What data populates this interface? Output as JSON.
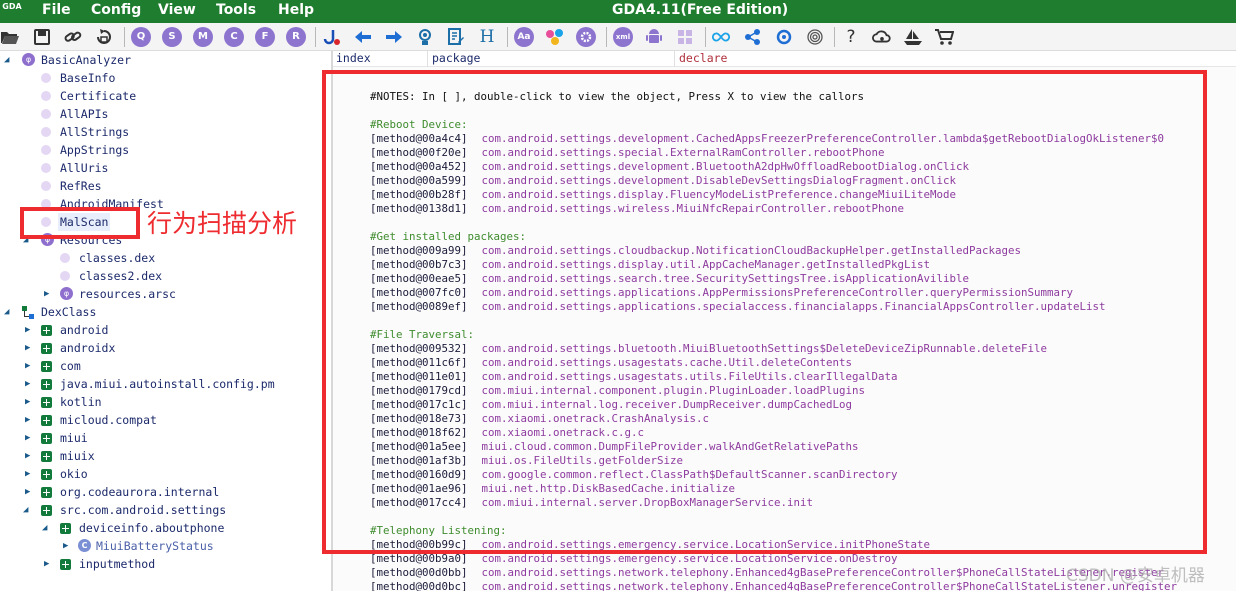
{
  "window": {
    "title": "GDA4.11(Free Edition)",
    "logo": "GDA"
  },
  "menu": [
    "File",
    "Config",
    "View",
    "Tools",
    "Help"
  ],
  "toolbar": {
    "icons": [
      "open-folder-icon",
      "save-icon",
      "link-icon",
      "refresh-icon",
      "q-icon",
      "s-icon",
      "m-icon",
      "c-icon",
      "f-icon",
      "r-icon",
      "jump-icon",
      "back-arrow-icon",
      "forward-arrow-icon",
      "bulb-icon",
      "edit-icon",
      "h-icon",
      "font-icon",
      "network-icon",
      "gear-icon",
      "xml-icon",
      "android-icon",
      "windows-icon",
      "infinity-icon",
      "graph-icon",
      "crosshair-icon",
      "fingerprint-icon",
      "help-icon",
      "cloud-icon",
      "ship-icon",
      "cart-icon"
    ],
    "letters": {
      "q": "Q",
      "s": "S",
      "m": "M",
      "c": "C",
      "f": "F",
      "r": "R",
      "h": "H",
      "help": "?",
      "font": "Aa",
      "xml": "xml"
    }
  },
  "tree": {
    "root": "BasicAnalyzer",
    "analyzer_items": [
      "BaseInfo",
      "Certificate",
      "AllAPIs",
      "AllStrings",
      "AppStrings",
      "AllUris",
      "RefRes",
      "AndroidManifest",
      "MalScan"
    ],
    "resources": {
      "label": "Resources",
      "children": [
        "classes.dex",
        "classes2.dex",
        "resources.arsc"
      ]
    },
    "dexclass": {
      "label": "DexClass",
      "packages": [
        "android",
        "androidx",
        "com",
        "java.miui.autoinstall.config.pm",
        "kotlin",
        "micloud.compat",
        "miui",
        "miuix",
        "okio",
        "org.codeaurora.internal",
        "src.com.android.settings"
      ]
    },
    "settings_children": [
      "deviceinfo.aboutphone",
      "MiuiBatteryStatus",
      "inputmethod"
    ],
    "phi_glyph": "φ",
    "class_glyph": "C"
  },
  "columns": [
    "index",
    "package",
    "declare"
  ],
  "code": {
    "note": "#NOTES: In [ ], double-click to view the object, Press X to view the callors",
    "sections": [
      {
        "heading": "#Reboot Device:",
        "entries": [
          [
            "[method@00a4c4]",
            "com.android.settings.development.CachedAppsFreezerPreferenceController.lambda$getRebootDialogOkListener$0"
          ],
          [
            "[method@00f20e]",
            "com.android.settings.special.ExternalRamController.rebootPhone"
          ],
          [
            "[method@00a452]",
            "com.android.settings.development.BluetoothA2dpHwOffloadRebootDialog.onClick"
          ],
          [
            "[method@00a599]",
            "com.android.settings.development.DisableDevSettingsDialogFragment.onClick"
          ],
          [
            "[method@00b28f]",
            "com.android.settings.display.FluencyModeListPreference.changeMiuiLiteMode"
          ],
          [
            "[method@0138d1]",
            "com.android.settings.wireless.MiuiNfcRepairController.rebootPhone"
          ]
        ]
      },
      {
        "heading": "#Get installed packages:",
        "entries": [
          [
            "[method@009a99]",
            "com.android.settings.cloudbackup.NotificationCloudBackupHelper.getInstalledPackages"
          ],
          [
            "[method@00b7c3]",
            "com.android.settings.display.util.AppCacheManager.getInstalledPkgList"
          ],
          [
            "[method@00eae5]",
            "com.android.settings.search.tree.SecuritySettingsTree.isApplicationAvilible"
          ],
          [
            "[method@007fc0]",
            "com.android.settings.applications.AppPermissionsPreferenceController.queryPermissionSummary"
          ],
          [
            "[method@0089ef]",
            "com.android.settings.applications.specialaccess.financialapps.FinancialAppsController.updateList"
          ]
        ]
      },
      {
        "heading": "#File Traversal:",
        "entries": [
          [
            "[method@009532]",
            "com.android.settings.bluetooth.MiuiBluetoothSettings$DeleteDeviceZipRunnable.deleteFile"
          ],
          [
            "[method@011c6f]",
            "com.android.settings.usagestats.cache.Util.deleteContents"
          ],
          [
            "[method@011e01]",
            "com.android.settings.usagestats.utils.FileUtils.clearIllegalData"
          ],
          [
            "[method@0179cd]",
            "com.miui.internal.component.plugin.PluginLoader.loadPlugins"
          ],
          [
            "[method@017c1c]",
            "com.miui.internal.log.receiver.DumpReceiver.dumpCachedLog"
          ],
          [
            "[method@018e73]",
            "com.xiaomi.onetrack.CrashAnalysis.c"
          ],
          [
            "[method@018f62]",
            "com.xiaomi.onetrack.c.g.c"
          ],
          [
            "[method@01a5ee]",
            "miui.cloud.common.DumpFileProvider.walkAndGetRelativePaths"
          ],
          [
            "[method@01af3b]",
            "miui.os.FileUtils.getFolderSize"
          ],
          [
            "[method@0160d9]",
            "com.google.common.reflect.ClassPath$DefaultScanner.scanDirectory"
          ],
          [
            "[method@01ae96]",
            "miui.net.http.DiskBasedCache.initialize"
          ],
          [
            "[method@017cc4]",
            "com.miui.internal.server.DropBoxManagerService.init"
          ]
        ]
      },
      {
        "heading": "#Telephony Listening:",
        "entries": [
          [
            "[method@00b99c]",
            "com.android.settings.emergency.service.LocationService.initPhoneState"
          ],
          [
            "[method@00b9a0]",
            "com.android.settings.emergency.service.LocationService.onDestroy"
          ],
          [
            "[method@00d0bb]",
            "com.android.settings.network.telephony.Enhanced4gBasePreferenceController$PhoneCallStateListener.register"
          ],
          [
            "[method@00d0bc]",
            "com.android.settings.network.telephony.Enhanced4gBasePreferenceController$PhoneCallStateListener.unregister"
          ]
        ]
      }
    ]
  },
  "annotation": {
    "label": "行为扫描分析",
    "color": "#ee2b2f"
  },
  "watermark": "CSDN @安卓机器",
  "colors": {
    "menubar": "#1f7d2f",
    "code_signature": "#8e3b9f",
    "code_heading": "#3f8c2e",
    "annotation": "#ee2b2f"
  }
}
